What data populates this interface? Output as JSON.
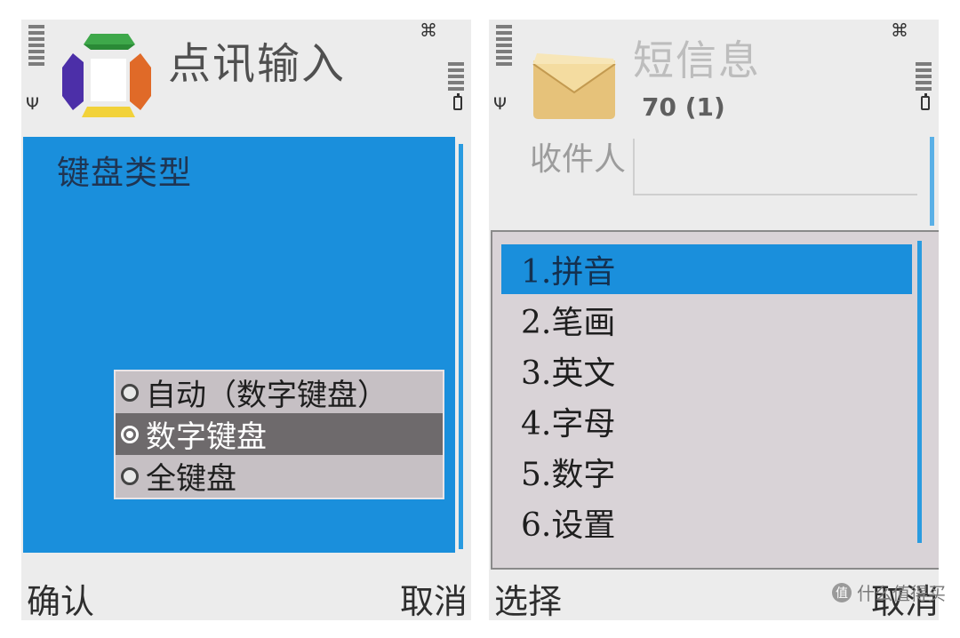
{
  "left_screen": {
    "title": "点讯输入",
    "heading": "键盘类型",
    "options": [
      {
        "label": "自动（数字键盘）",
        "selected": false
      },
      {
        "label": "数字键盘",
        "selected": true
      },
      {
        "label": "全键盘",
        "selected": false
      }
    ],
    "softkey_left": "确认",
    "softkey_right": "取消"
  },
  "right_screen": {
    "title": "短信息",
    "char_count": "70 (1)",
    "recipient_label": "收件人",
    "menu": [
      {
        "label": "1.拼音",
        "selected": true
      },
      {
        "label": "2.笔画",
        "selected": false
      },
      {
        "label": "3.英文",
        "selected": false
      },
      {
        "label": "4.字母",
        "selected": false
      },
      {
        "label": "5.数字",
        "selected": false
      },
      {
        "label": "6.设置",
        "selected": false
      }
    ],
    "softkey_left": "选择",
    "softkey_right": "取消"
  },
  "watermark": {
    "icon_text": "值",
    "text": "什么值得买"
  },
  "colors": {
    "highlight_blue": "#1a8fdc",
    "screen_bg": "#ececec",
    "option_bg": "#c6c0c4",
    "option_selected_bg": "#6e6a6c"
  },
  "icons": {
    "clover": "clover-icon",
    "signal": "signal-strength-icon",
    "antenna": "antenna-icon",
    "battery": "battery-icon",
    "app_logo": "dianxun-logo-icon",
    "envelope": "envelope-icon"
  }
}
